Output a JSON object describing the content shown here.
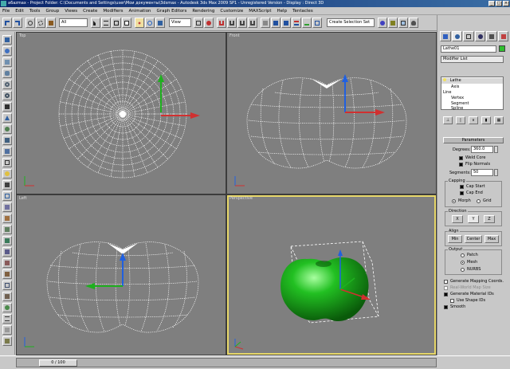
{
  "window": {
    "title": "a6azmax - Project Folder: C:\\Documents and Settings\\user\\Мои документы\\3dsmax - Autodesk 3ds Max 2009 SP1 - Unregistered Version - Display : Direct 3D"
  },
  "menu": [
    "File",
    "Edit",
    "Tools",
    "Group",
    "Views",
    "Create",
    "Modifiers",
    "Animation",
    "Graph Editors",
    "Rendering",
    "Customize",
    "MAXScript",
    "Help",
    "Tentacles"
  ],
  "toolbar": {
    "selection_filter": "All",
    "ref_coord": "View",
    "named_selection": "Create Selection Set"
  },
  "viewports": {
    "top": {
      "label": "Top"
    },
    "front": {
      "label": "Front"
    },
    "left": {
      "label": "Left"
    },
    "perspective": {
      "label": "Perspective"
    }
  },
  "command_panel": {
    "object_name": "Lathe01",
    "modifier_list": "Modifier List",
    "color": "#2fbf2f",
    "stack": [
      "Lathe",
      "Axis",
      "Line",
      "Vertex",
      "Segment",
      "Spline"
    ]
  },
  "parameters": {
    "title": "Parameters",
    "degrees_label": "Degrees:",
    "degrees_value": "360.0",
    "weld_core": "Weld Core",
    "flip_normals": "Flip Normals",
    "segments_label": "Segments:",
    "segments_value": "50",
    "capping_title": "Capping",
    "cap_start": "Cap Start",
    "cap_end": "Cap End",
    "morph": "Morph",
    "grid": "Grid",
    "direction_title": "Direction",
    "dir_x": "X",
    "dir_y": "Y",
    "dir_z": "Z",
    "align_title": "Align",
    "align_min": "Min",
    "align_center": "Center",
    "align_max": "Max",
    "output_title": "Output",
    "out_patch": "Patch",
    "out_mesh": "Mesh",
    "out_nurbs": "NURBS",
    "gen_mapping": "Generate Mapping Coords.",
    "real_world": "Real-World Map Size",
    "gen_material": "Generate Material IDs",
    "use_shape_ids": "Use Shape IDs",
    "smooth": "Smooth"
  },
  "timeline": {
    "frame_label": "0 / 100"
  }
}
